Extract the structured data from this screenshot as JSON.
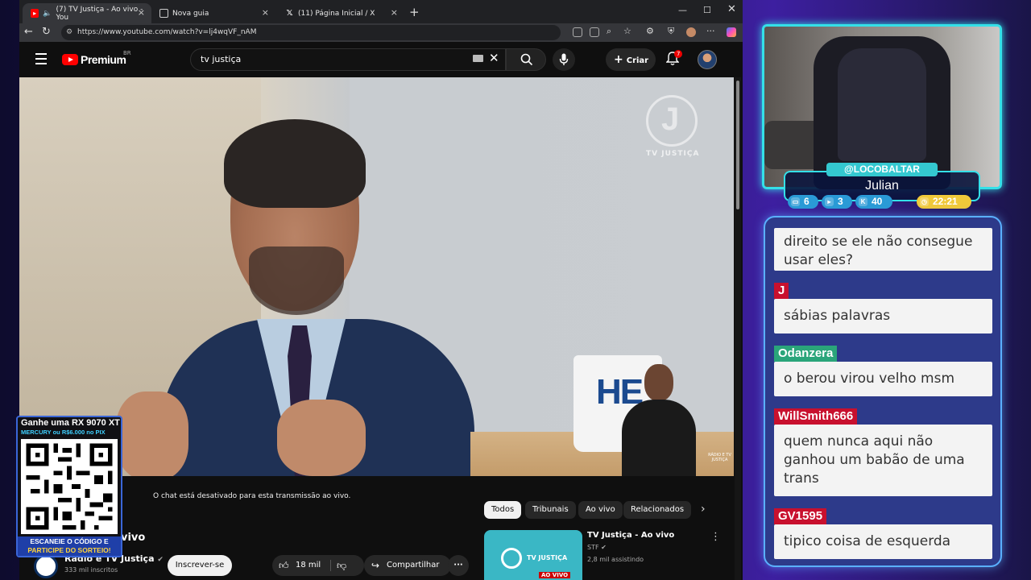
{
  "browser": {
    "tabs": [
      {
        "title": "(7) TV Justiça - Ao vivo - You",
        "active": true
      },
      {
        "title": "Nova guia",
        "active": false
      },
      {
        "title": "(11) Página Inicial / X",
        "active": false
      }
    ],
    "url": "https://www.youtube.com/watch?v=lj4wqVF_nAM"
  },
  "youtube": {
    "logo_text": "Premium",
    "region": "BR",
    "search_value": "tv justiça",
    "create_label": "Criar",
    "notifications": "7"
  },
  "video": {
    "watermark": "TV JUSTIÇA",
    "mug_text": "HE",
    "small_watermark": "RÁDIO E TV JUSTIÇA"
  },
  "below_video": {
    "chat_disabled": "O chat está desativado para esta transmissão ao vivo.",
    "title_fragment": "vivo",
    "channel_name": "Rádio e TV Justiça",
    "subscribers": "333 mil inscritos",
    "subscribe_label": "Inscrever-se",
    "likes": "18 mil",
    "share_label": "Compartilhar"
  },
  "chips": [
    "Todos",
    "Tribunais",
    "Ao vivo",
    "Relacionados"
  ],
  "related": {
    "title": "TV Justiça - Ao vivo",
    "channel": "STF",
    "views": "2,8 mil assistindo",
    "thumb_text": "TV JUSTIÇA",
    "live_badge": "AO VIVO"
  },
  "giveaway": {
    "line1": "Ganhe uma RX 9070 XT",
    "line2": "MERCURY ou R$6.000 no PIX",
    "line3a": "ESCANEIE O CÓDIGO E",
    "line3b": "PARTICIPE DO SORTEIO!"
  },
  "streamer": {
    "handle": "@LOCOBALTAR",
    "name": "Julian",
    "stats": [
      {
        "icon": "chat-icon",
        "value": "6"
      },
      {
        "icon": "youtube-icon",
        "value": "3"
      },
      {
        "icon": "kick-icon",
        "value": "40"
      },
      {
        "icon": "clock-icon",
        "value": "22:21"
      }
    ]
  },
  "chat_messages": [
    {
      "user": "",
      "text": "direito se ele não consegue usar eles?"
    },
    {
      "user": "J",
      "text": "sábias palavras",
      "color": "#c8102e"
    },
    {
      "user": "Odanzera",
      "text": "o berou virou velho msm",
      "color": "#2aa57a"
    },
    {
      "user": "WillSmith666",
      "text": "quem nunca aqui não ganhou um babão de uma trans",
      "color": "#c8102e"
    },
    {
      "user": "GV1595",
      "text": "tipico coisa de esquerda",
      "color": "#c8102e"
    }
  ]
}
